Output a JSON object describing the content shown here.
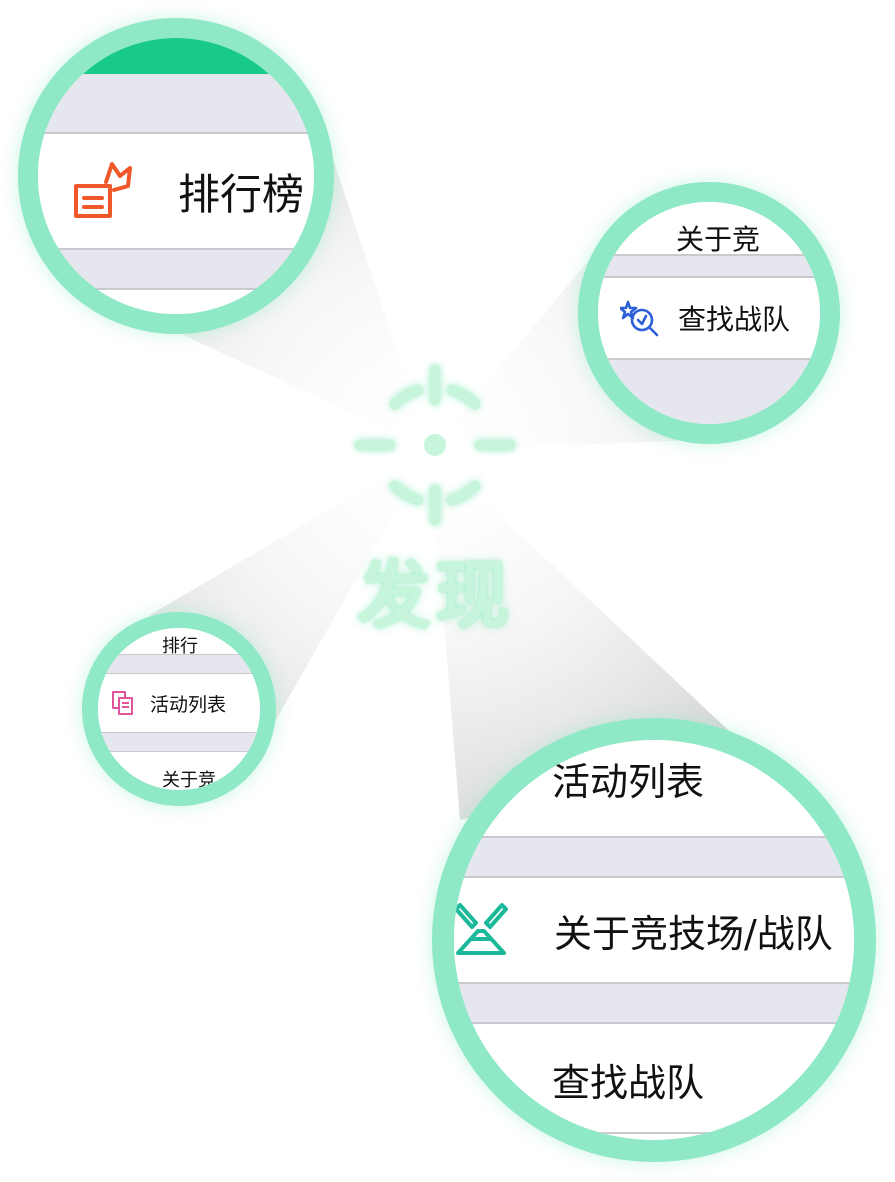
{
  "center": {
    "title": "发现",
    "icon": "target-crosshair-icon",
    "color": "#c6f5dc"
  },
  "magnifiers": {
    "top_left": {
      "item_label": "排行榜",
      "item_icon": "ranking-crown-icon",
      "icon_color": "#f0582a"
    },
    "top_right": {
      "top_partial": "关于竞",
      "item_label": "查找战队",
      "item_icon": "search-team-icon",
      "icon_color": "#2d5fd6"
    },
    "middle_left": {
      "top_partial": "排行",
      "item_label": "活动列表",
      "bottom_partial": "关于竞",
      "item_icon": "activity-list-icon",
      "icon_color": "#e2549a"
    },
    "bottom_right": {
      "top_label": "活动列表",
      "item_label": "关于竞技场/战队",
      "bottom_label": "查找战队",
      "item_icon": "arena-swords-icon",
      "icon_color": "#1bb99a"
    }
  },
  "colors": {
    "ring": "#8fe8c6",
    "accent_green": "#19c98a",
    "separator": "#e6e6ee"
  }
}
